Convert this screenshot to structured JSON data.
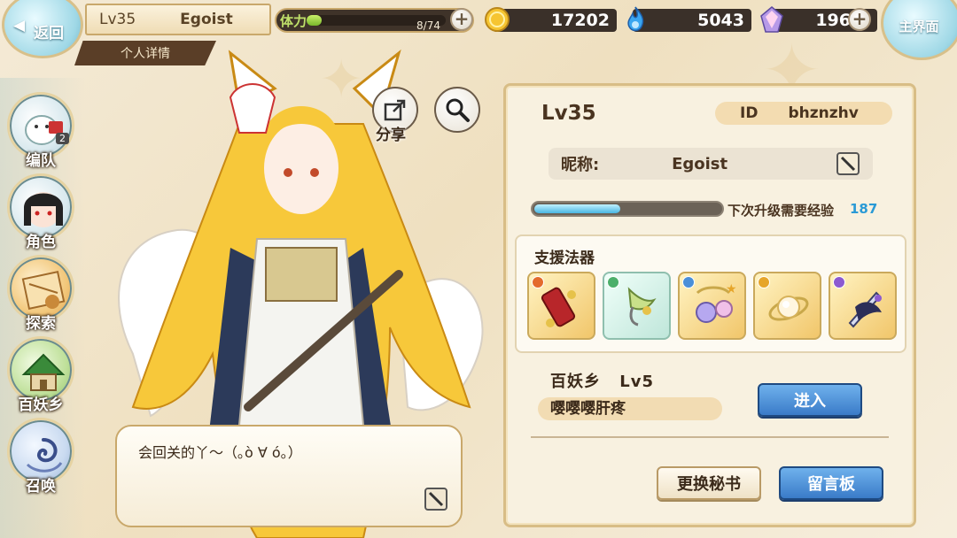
{
  "topbar": {
    "back_label": "返回",
    "player_level": "Lv35",
    "player_name": "Egoist",
    "detail_tab": "个人详情",
    "stamina_label": "体力",
    "stamina_value": "8/74",
    "stamina_fraction": 0.108,
    "gold": "17202",
    "spirit": "5043",
    "crystal": "196",
    "main_label": "主界面"
  },
  "sidebar": {
    "items": [
      {
        "label": "编队",
        "badge": "2"
      },
      {
        "label": "角色"
      },
      {
        "label": "探索"
      },
      {
        "label": "百妖乡"
      },
      {
        "label": "召唤"
      }
    ]
  },
  "character": {
    "share_label": "分享",
    "speech": "会回关的丫～（｡ò ∀ ó｡）"
  },
  "panel": {
    "level": "Lv35",
    "id_label": "ID",
    "id_value": "bhznzhv",
    "nickname_label": "昵称:",
    "nickname_value": "Egoist",
    "exp_label": "下次升级需要经验",
    "exp_value": "187",
    "exp_fraction": 0.47,
    "support_title": "支援法器",
    "support_items": [
      {
        "icon": "scroll-icon",
        "gem_color": "#e46b2c"
      },
      {
        "icon": "charm-icon",
        "gem_color": "#4caf6a"
      },
      {
        "icon": "orb-pendant-icon",
        "gem_color": "#4a8fd8"
      },
      {
        "icon": "crystal-ring-icon",
        "gem_color": "#e6a52a"
      },
      {
        "icon": "sword-icon",
        "gem_color": "#8c5ad0"
      }
    ],
    "village_name": "百妖乡",
    "village_level": "Lv5",
    "village_message": "嘤嘤嘤肝疼",
    "enter_label": "进入",
    "change_secretary_label": "更换秘书",
    "message_board_label": "留言板"
  },
  "colors": {
    "accent_blue": "#3a7bc8",
    "exp_value": "#2a9ad6",
    "panel_border": "#d8bd86"
  }
}
